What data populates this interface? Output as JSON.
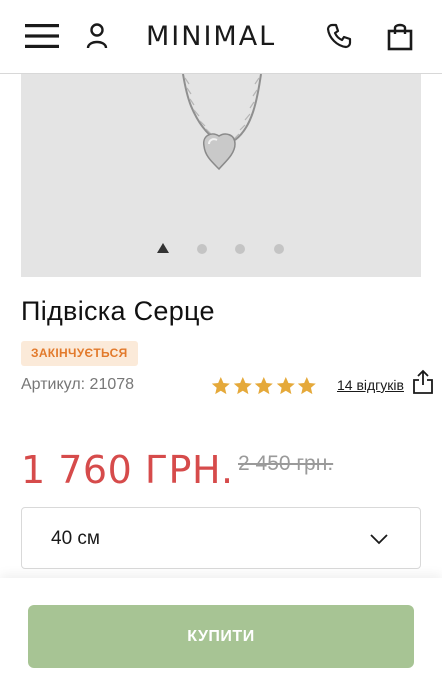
{
  "header": {
    "logo": "MINIMAL",
    "icons": [
      "menu-icon",
      "user-icon",
      "phone-icon",
      "bag-icon"
    ]
  },
  "gallery": {
    "image": "silver heart pendant on chain",
    "slides_count": 4,
    "active_slide": 1
  },
  "product": {
    "title": "Підвіска Серце",
    "badge": "ЗАКІНЧУЄТЬСЯ",
    "sku": "Артикул: 21078",
    "rating": 5,
    "reviews": "14 відгуків",
    "price": "1 760 ГРН.",
    "old_price": "2 450 грн."
  },
  "size_select": {
    "value": "40 см"
  },
  "buy_button": {
    "label": "КУПИТИ"
  },
  "colors": {
    "price": "#d64b4b",
    "badge_bg": "#fbead9",
    "badge_text": "#e27a2c",
    "star": "#e5a93a",
    "buy_bg": "#a7c494"
  }
}
